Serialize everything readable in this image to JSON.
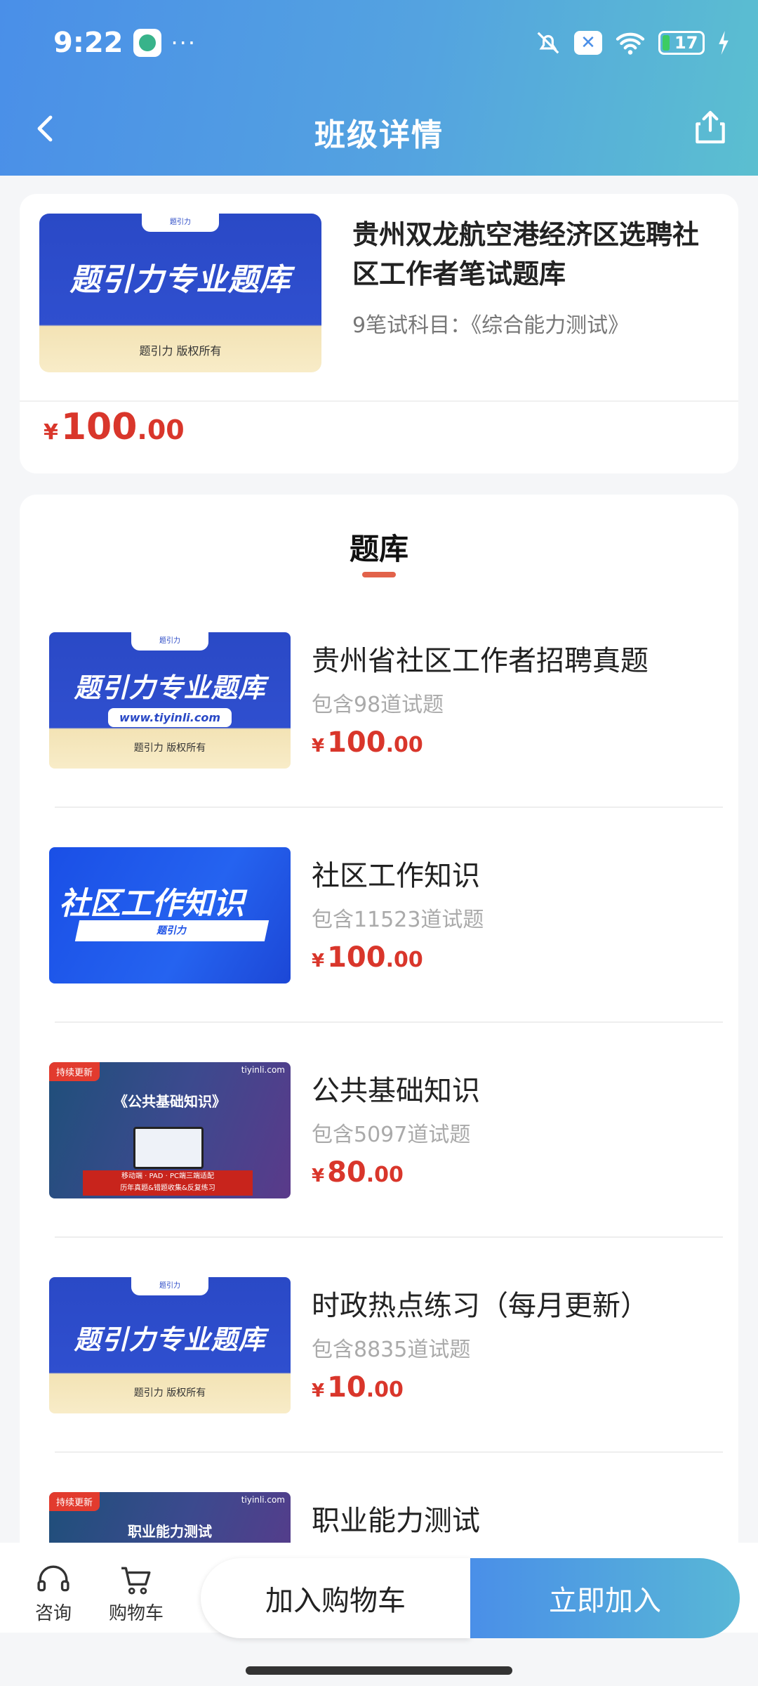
{
  "status": {
    "time": "9:22",
    "battery": "17"
  },
  "nav": {
    "title": "班级详情"
  },
  "course": {
    "cover_title": "题引力专业题库",
    "cover_tab": "题引力",
    "cover_footer": "题引力 版权所有",
    "title": "贵州双龙航空港经济区选聘社区工作者笔试题库",
    "subtitle": "9笔试科目：《综合能力测试》",
    "price": {
      "currency": "¥",
      "int": "100",
      "dec": ".00"
    }
  },
  "bank": {
    "section_title": "题库",
    "items": [
      {
        "name": "贵州省社区工作者招聘真题",
        "count": "包含98道试题",
        "price": {
          "currency": "¥",
          "int": "100",
          "dec": ".00"
        },
        "cover": {
          "tab": "题引力",
          "title": "题引力专业题库",
          "url": "www.tiyinli.com",
          "footer": "题引力 版权所有"
        }
      },
      {
        "name": "社区工作知识",
        "count": "包含11523道试题",
        "price": {
          "currency": "¥",
          "int": "100",
          "dec": ".00"
        },
        "cover": {
          "title": "社区工作知识",
          "bar": "题引力"
        }
      },
      {
        "name": "公共基础知识",
        "count": "包含5097道试题",
        "price": {
          "currency": "¥",
          "int": "80",
          "dec": ".00"
        },
        "cover": {
          "badge": "持续更新",
          "brand": "tiyinli.com",
          "heading": "《公共基础知识》",
          "band_line1": "移动端 · PAD · PC端三端适配",
          "band_line2": "历年真题&错题收集&反复练习"
        }
      },
      {
        "name": "时政热点练习（每月更新）",
        "count": "包含8835道试题",
        "price": {
          "currency": "¥",
          "int": "10",
          "dec": ".00"
        },
        "cover": {
          "tab": "题引力",
          "title": "题引力专业题库",
          "footer": "题引力 版权所有"
        }
      },
      {
        "name": "职业能力测试",
        "cover": {
          "badge": "持续更新",
          "brand": "tiyinli.com",
          "heading": "职业能力测试"
        }
      }
    ]
  },
  "bottom": {
    "consult": "咨询",
    "cart": "购物车",
    "add_to_cart": "加入购物车",
    "join_now": "立即加入"
  },
  "colors": {
    "header_start": "#4a8fe8",
    "header_end": "#5bbfd0",
    "price": "#d9362b",
    "accent_underline": "#e2624a"
  }
}
